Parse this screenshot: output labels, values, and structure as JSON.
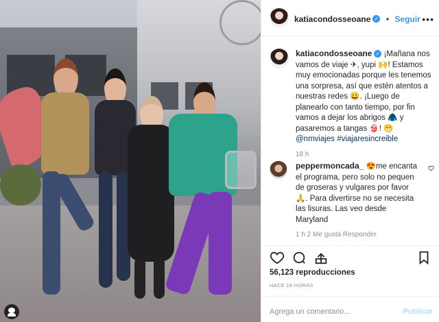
{
  "post": {
    "username": "katiacondosseoane",
    "follow_label": "Seguir",
    "caption": "¡Mañana nos vamos de viaje ✈, yupi 🙌! Estamos muy emocionadas porque les tenemos una sorpresa, así que estén atentos a nuestras redes 😀. ¡Luego de planearlo con tanto tiempo, por fin vamos a dejar los abrigos 🧥 y pasaremos a tangas 👙! 😁",
    "caption_mentions": "@nmviajes",
    "caption_hashtag": "#viajaresincreible",
    "caption_time": "18 h"
  },
  "comments": [
    {
      "username": "peppermoncada_",
      "text": "😍me encanta el programa, pero solo no pequen de groseras y vulgares por favor 🙏. Para divertirse no se necesita las lisuras. Las veo desde Maryland",
      "meta": "1 h   2 Me gusta   Responder"
    }
  ],
  "stats": {
    "views": "56,123 reproducciones",
    "time_ago": "HACE 18 HORAS"
  },
  "add_comment": {
    "placeholder": "Agrega un comentario...",
    "publish_label": "Publicar"
  },
  "icons": [
    "heart-icon",
    "comment-icon",
    "share-icon",
    "bookmark-icon",
    "more-options-icon",
    "mute-icon",
    "verified-icon"
  ],
  "colors": {
    "accent": "#3897f0",
    "link": "#003569",
    "muted": "#8e8e8e",
    "publish_disabled": "#b2dffc"
  }
}
